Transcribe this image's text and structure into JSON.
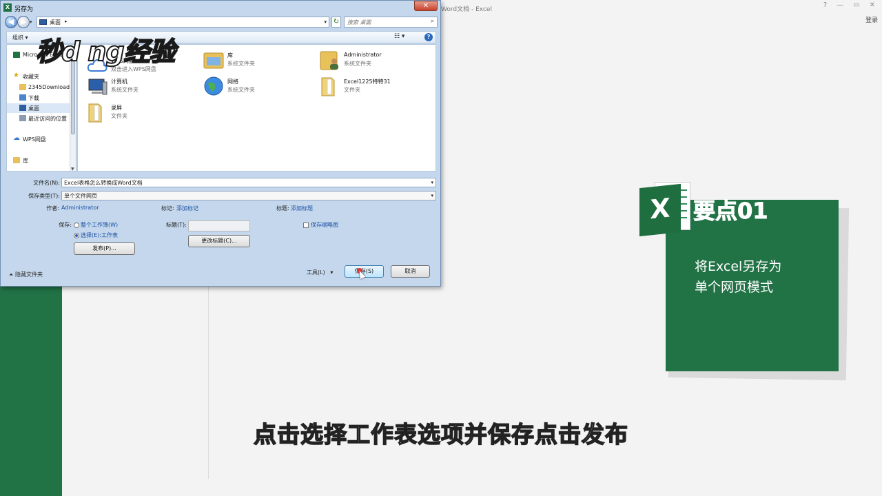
{
  "excel_window": {
    "title": "Word文档 - Excel",
    "login": "登录",
    "window_controls": [
      "?",
      "—",
      "▭",
      "✕"
    ]
  },
  "dialog": {
    "title": "另存为",
    "address": {
      "location": "桌面",
      "separator": "▸"
    },
    "search": {
      "placeholder": "搜索 桌面"
    },
    "toolbar": {
      "organize": "组织 ▾"
    },
    "nav_items": [
      {
        "label": "Microsoft Excel"
      },
      {
        "label": "收藏夹"
      },
      {
        "label": "2345Downloads"
      },
      {
        "label": "下载"
      },
      {
        "label": "桌面"
      },
      {
        "label": "最近访问的位置"
      },
      {
        "label": "WPS网盘"
      },
      {
        "label": "库"
      }
    ],
    "files": [
      {
        "name": "WPS网盘",
        "type": "双击进入WPS网盘"
      },
      {
        "name": "库",
        "type": "系统文件夹"
      },
      {
        "name": "Administrator",
        "type": "系统文件夹"
      },
      {
        "name": "计算机",
        "type": "系统文件夹"
      },
      {
        "name": "网络",
        "type": "系统文件夹"
      },
      {
        "name": "Excel1225特特31",
        "type": "文件夹"
      },
      {
        "name": "录屏",
        "type": "文件夹"
      }
    ],
    "form": {
      "filename_label": "文件名(N):",
      "filename_value": "Excel表格怎么转换成Word文档",
      "filetype_label": "保存类型(T):",
      "filetype_value": "单个文件网页",
      "author_label": "作者:",
      "author_value": "Administrator",
      "tags_label": "标记:",
      "tags_value": "添加标记",
      "title_label": "标题:",
      "title_value": "添加标题",
      "save_label": "保存:",
      "radio_workbook": "整个工作簿(W)",
      "radio_sheet": "选择(E):工作表",
      "publish_button": "发布(P)...",
      "page_title_label": "标题(T):",
      "change_title_button": "更改标题(C)...",
      "thumbnail_label": "保存缩略图",
      "hide_folders": "隐藏文件夹",
      "tools": "工具(L)",
      "save_button": "保存(S)",
      "cancel_button": "取消"
    }
  },
  "logo_text": "秒d ng经验",
  "card": {
    "icon_letter": "X",
    "title": "要点01",
    "line1": "将Excel另存为",
    "line2": "单个网页模式"
  },
  "subtitle": "点击选择工作表选项并保存点击发布"
}
